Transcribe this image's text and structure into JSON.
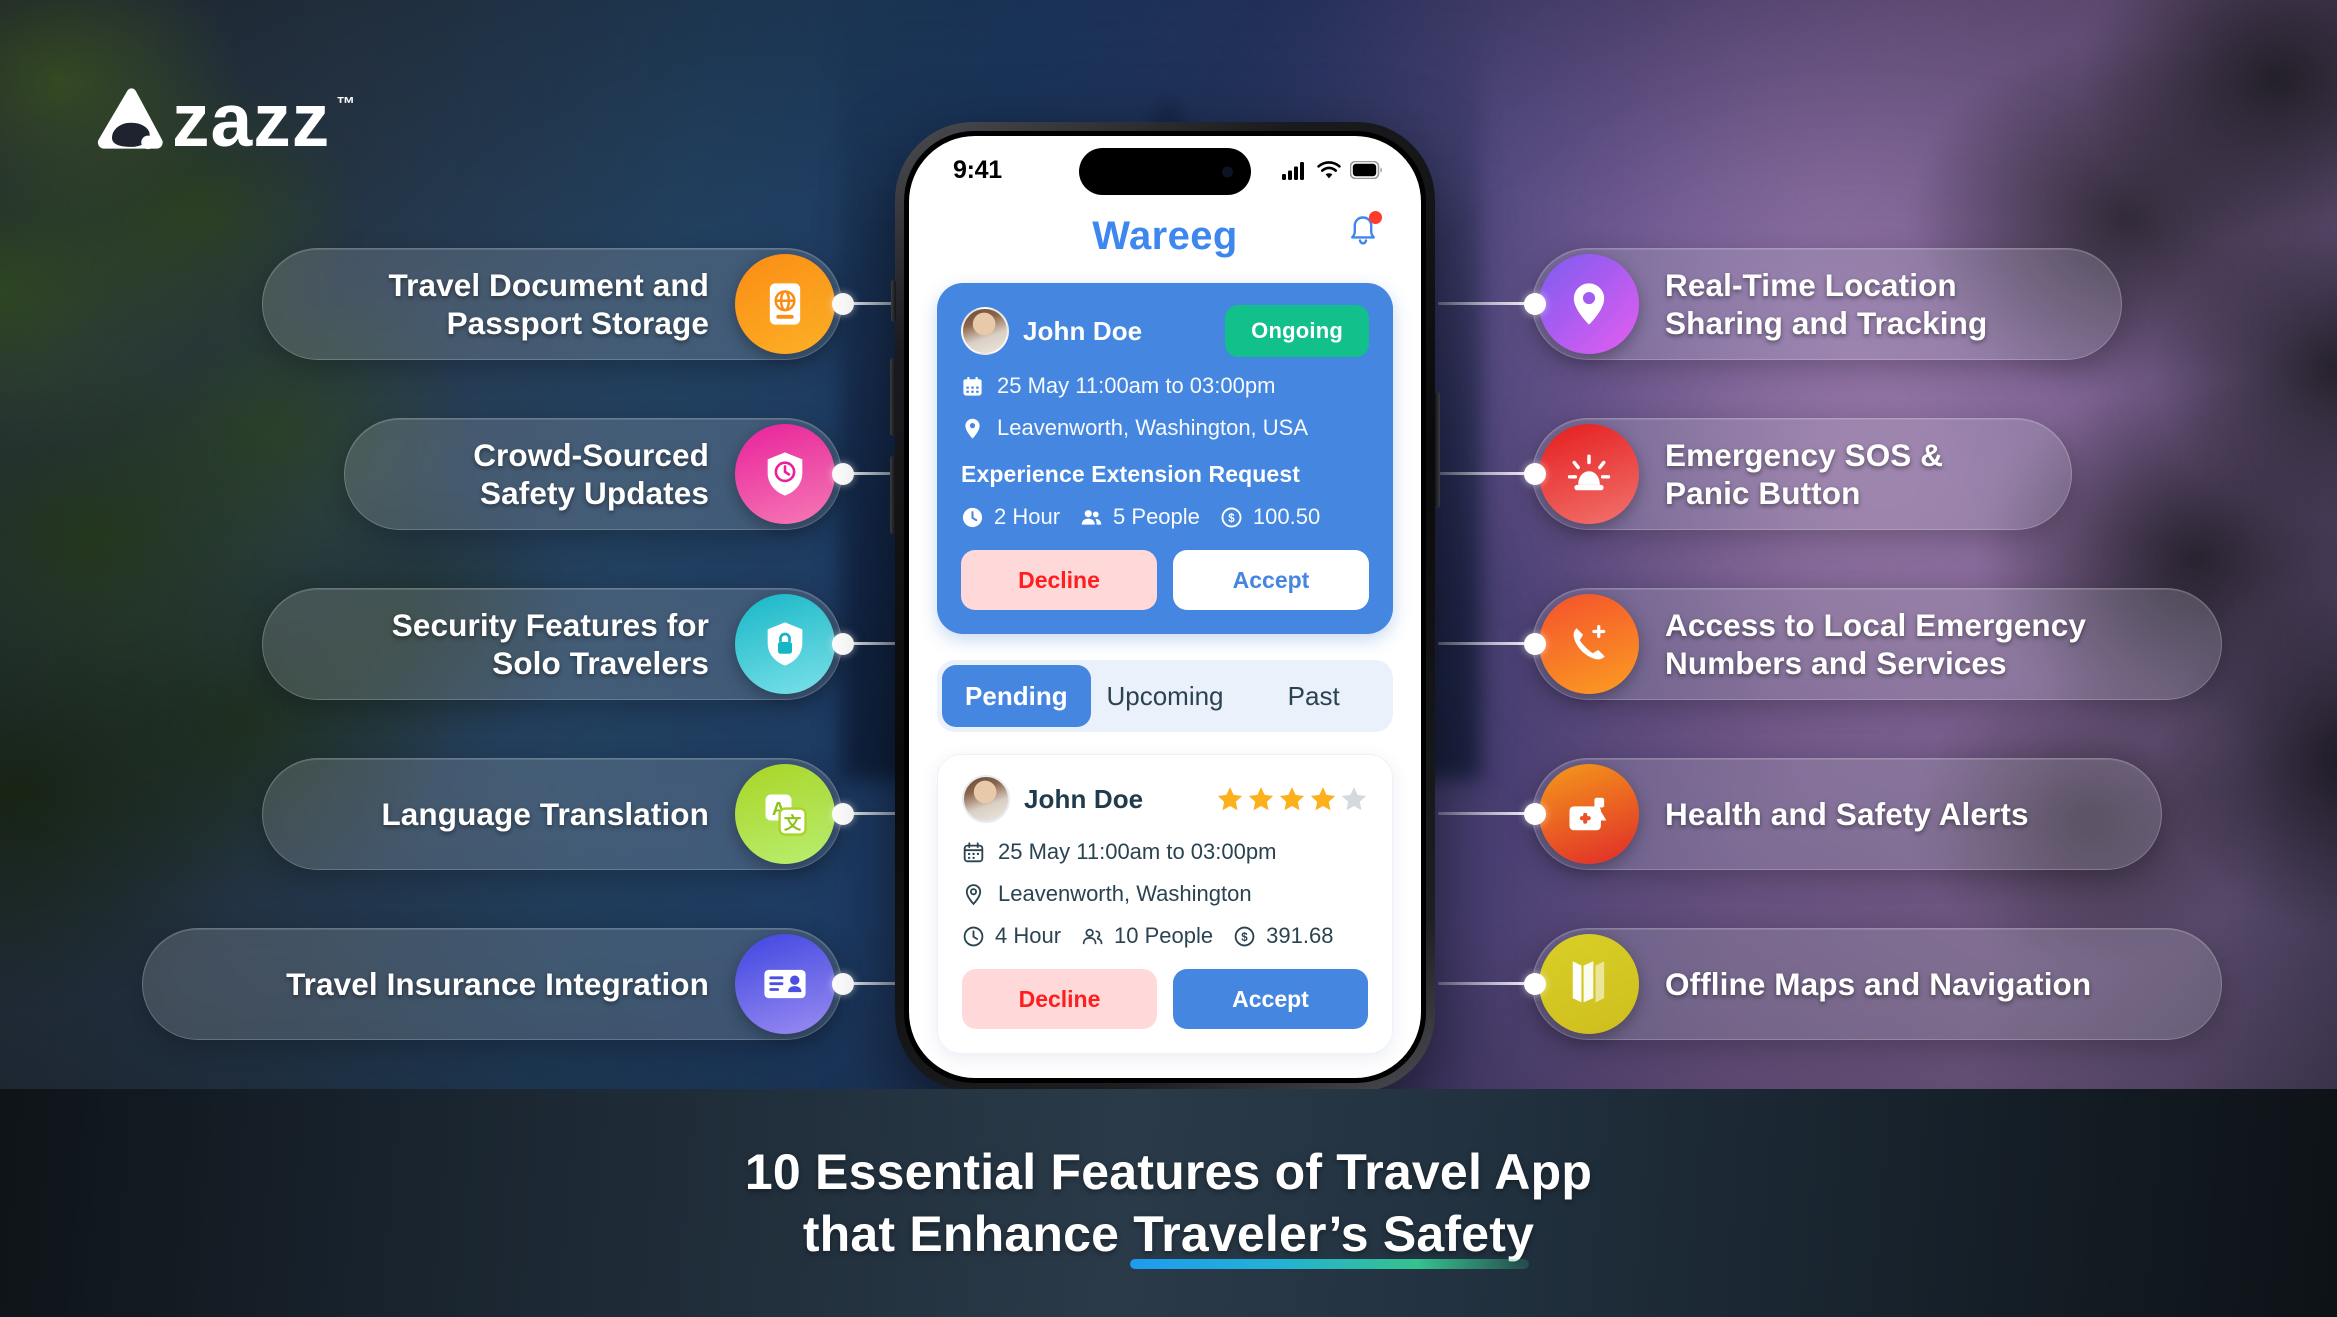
{
  "brand": {
    "logo_word": "zazz",
    "trademark": "™",
    "logo_mark_icon": "zazz-triangle-logo-icon"
  },
  "bottom_banner": {
    "title": "10 Essential Features of Travel App\nthat Enhance Traveler’s Safety",
    "underline_gradient_from": "#1e9bf0",
    "underline_gradient_to": "#35c28d"
  },
  "features_left": [
    {
      "label": "Travel Document and\nPassport Storage",
      "icon": "passport-globe-icon",
      "color_from": "#fb8c14",
      "color_to": "#fcb127"
    },
    {
      "label": "Crowd-Sourced\nSafety Updates",
      "icon": "shield-clock-icon",
      "color_from": "#e8219a",
      "color_to": "#f67ab5"
    },
    {
      "label": "Security Features for\nSolo Travelers",
      "icon": "shield-lock-icon",
      "color_from": "#17b6c6",
      "color_to": "#7ce2ea"
    },
    {
      "label": "Language Translation",
      "icon": "translate-icon",
      "color_from": "#a9d425",
      "color_to": "#b9ef72"
    },
    {
      "label": "Travel Insurance Integration",
      "icon": "id-card-icon",
      "color_from": "#3e46e0",
      "color_to": "#9b8cf2"
    }
  ],
  "features_right": [
    {
      "label": "Real-Time Location\nSharing and Tracking",
      "icon": "location-pin-icon",
      "color_from": "#7b5cf0",
      "color_to": "#e45df0"
    },
    {
      "label": "Emergency SOS &\nPanic Button",
      "icon": "siren-alarm-icon",
      "color_from": "#e51d1d",
      "color_to": "#f1736e"
    },
    {
      "label": "Access to Local Emergency\nNumbers and Services",
      "icon": "phone-plus-icon",
      "color_from": "#f4512c",
      "color_to": "#fb9d22"
    },
    {
      "label": "Health and Safety Alerts",
      "icon": "medical-kit-icon",
      "color_from": "#f59a1a",
      "color_to": "#e02a2a"
    },
    {
      "label": "Offline Maps and Navigation",
      "icon": "map-fold-icon",
      "color_from": "#d8cf26",
      "color_to": "#cfbe1e"
    }
  ],
  "phone": {
    "status_bar": {
      "time": "9:41",
      "cellular_icon": "signal-bars-icon",
      "wifi_icon": "wifi-icon",
      "battery_icon": "battery-full-icon"
    },
    "app_header": {
      "title": "Wareeg",
      "title_color": "#3d87ee",
      "notification_icon": "bell-icon",
      "notification_dot_color": "#ff3b30"
    },
    "ongoing_card": {
      "avatar_icon": "user-avatar",
      "user_name": "John Doe",
      "status_badge": "Ongoing",
      "status_badge_color": "#12c08b",
      "date_icon": "calendar-icon",
      "date_time": "25 May 11:00am to 03:00pm",
      "location_icon": "map-pin-icon",
      "location": "Leavenworth, Washington, USA",
      "section_title": "Experience Extension Request",
      "duration_icon": "clock-icon",
      "duration": "2 Hour",
      "people_icon": "people-icon",
      "people": "5 People",
      "price_icon": "dollar-coin-icon",
      "price": "100.50",
      "decline_label": "Decline",
      "accept_label": "Accept"
    },
    "tabs": [
      {
        "label": "Pending",
        "active": true
      },
      {
        "label": "Upcoming",
        "active": false
      },
      {
        "label": "Past",
        "active": false
      }
    ],
    "pending_card": {
      "avatar_icon": "user-avatar",
      "user_name": "John Doe",
      "rating_filled": 4,
      "rating_total": 5,
      "star_color": "#fbb01c",
      "star_empty_color": "#d4d9de",
      "date_icon": "calendar-icon",
      "date_time": "25 May 11:00am to 03:00pm",
      "location_icon": "map-pin-icon",
      "location": "Leavenworth, Washington",
      "duration_icon": "clock-icon",
      "duration": "4 Hour",
      "people_icon": "people-icon",
      "people": "10 People",
      "price_icon": "dollar-coin-icon",
      "price": "391.68",
      "decline_label": "Decline",
      "accept_label": "Accept"
    }
  }
}
